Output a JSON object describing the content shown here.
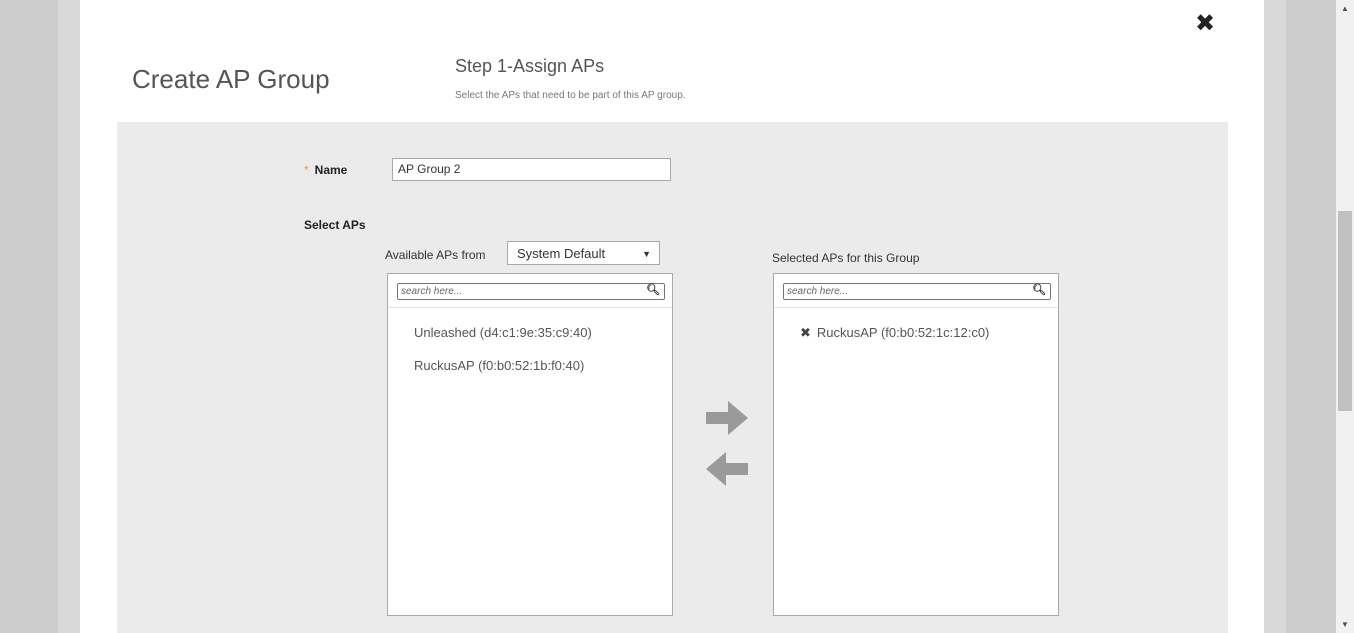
{
  "dialog": {
    "title": "Create AP Group",
    "step_title": "Step 1-Assign APs",
    "step_subtitle": "Select the APs that need to be part of this AP group.",
    "close_icon": "close-icon"
  },
  "form": {
    "required_marker": "*",
    "name_label": "Name",
    "name_value": "AP Group 2",
    "select_aps_label": "Select APs",
    "available_label": "Available APs from",
    "available_source": "System Default",
    "selected_label": "Selected APs for this Group"
  },
  "available_list": {
    "search_placeholder": "search here...",
    "items": [
      "Unleashed (d4:c1:9e:35:c9:40)",
      "RuckusAP (f0:b0:52:1b:f0:40)"
    ]
  },
  "selected_list": {
    "search_placeholder": "search here...",
    "items": [
      "RuckusAP (f0:b0:52:1c:12:c0)"
    ]
  },
  "colors": {
    "required": "#f39c12",
    "arrow": "#9a9a9a",
    "panel": "#ebebeb"
  }
}
